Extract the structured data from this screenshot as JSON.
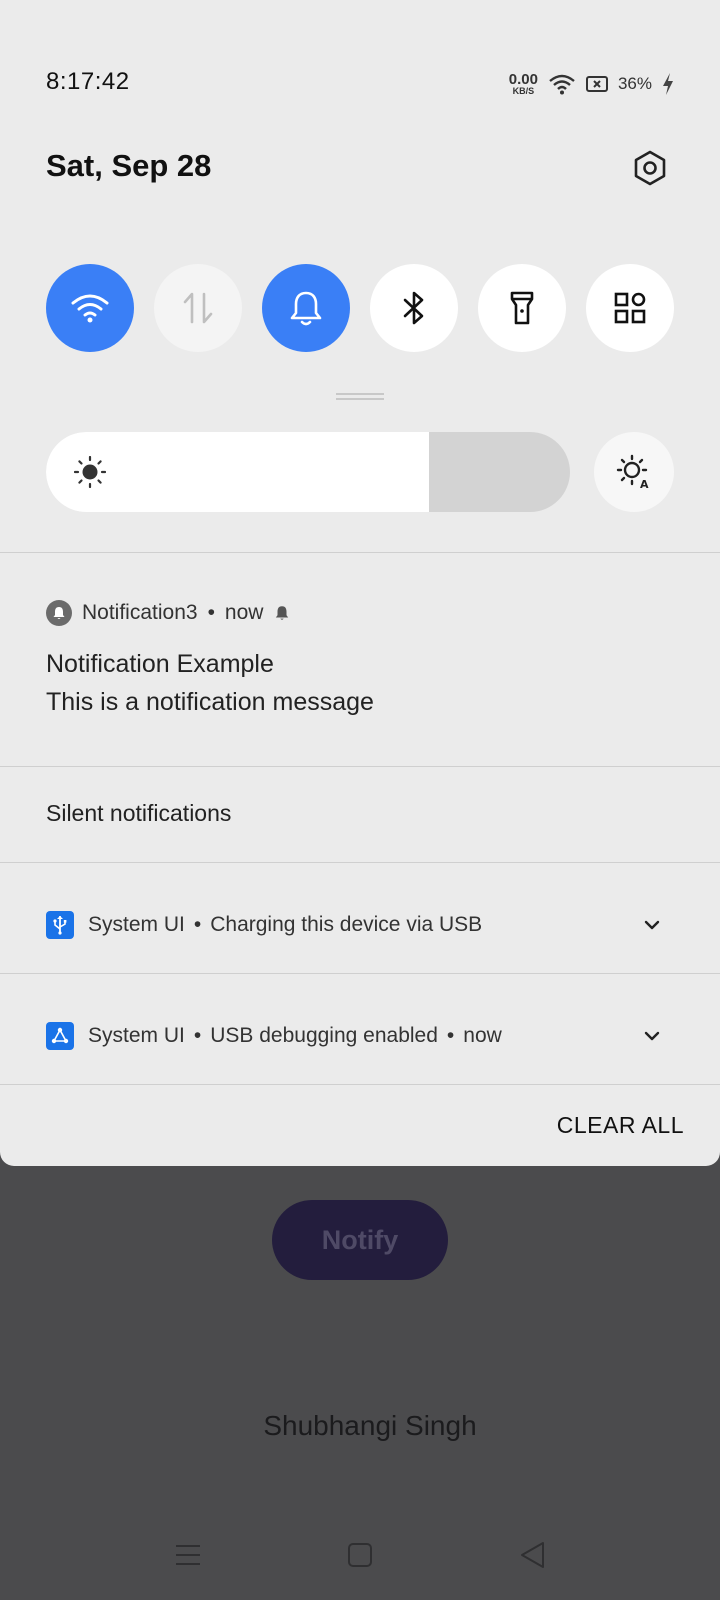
{
  "status_bar": {
    "time": "8:17:42",
    "net_speed_value": "0.00",
    "net_speed_unit": "KB/S",
    "battery_percent": "36%"
  },
  "header": {
    "date": "Sat, Sep 28"
  },
  "quick_tiles": [
    {
      "icon": "wifi-icon",
      "state": "on"
    },
    {
      "icon": "mobile-data-icon",
      "state": "unavailable"
    },
    {
      "icon": "bell-icon",
      "state": "on"
    },
    {
      "icon": "bluetooth-icon",
      "state": "off"
    },
    {
      "icon": "flashlight-icon",
      "state": "off"
    },
    {
      "icon": "grid-icon",
      "state": "off"
    }
  ],
  "brightness": {
    "level": 0.73
  },
  "notification": {
    "app": "Notification3",
    "time": "now",
    "title": "Notification Example",
    "message": "This is a notification message"
  },
  "silent_section": {
    "label": "Silent notifications"
  },
  "system_notifications": [
    {
      "app": "System UI",
      "text": "Charging this device via USB",
      "time": ""
    },
    {
      "app": "System UI",
      "text": "USB debugging enabled",
      "time": "now"
    }
  ],
  "clear_all_label": "CLEAR ALL",
  "background_app": {
    "notify_button": "Notify",
    "author": "Shubhangi Singh"
  },
  "colors": {
    "accent": "#3a7ff6",
    "shade_bg": "#ebebeb",
    "system_icon": "#1a73e8",
    "app_bg": "#4b4b4d"
  }
}
